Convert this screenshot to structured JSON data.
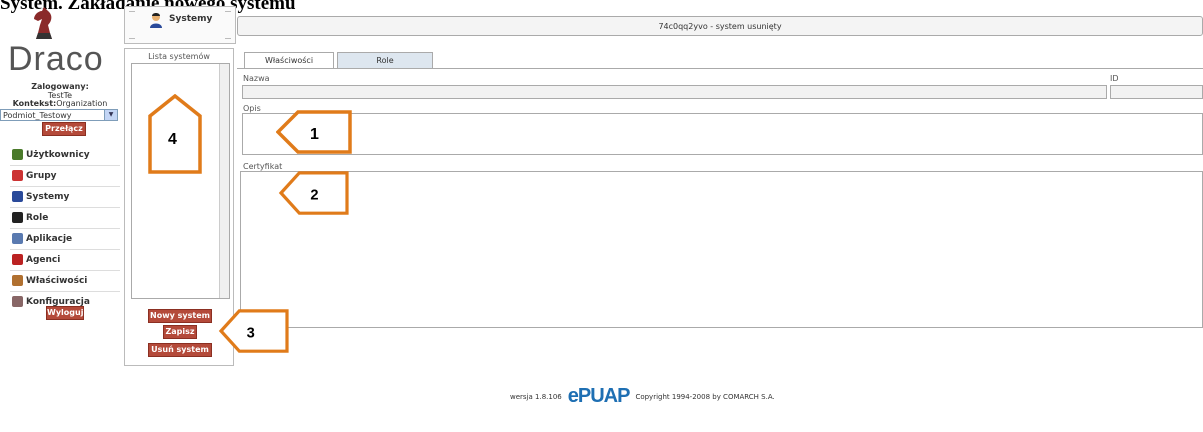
{
  "heading": "System. Zakładanie nowego systemu",
  "logo": {
    "text": "Draco"
  },
  "session": {
    "logged_label": "Zalogowany:",
    "user": "TestTe",
    "context_label": "Kontekst:",
    "context_value": "Organization",
    "subject_select": "Podmiot_Testowy",
    "switch_button": "Przełącz"
  },
  "nav": [
    {
      "label": "Użytkownicy",
      "icon": "users-icon",
      "color": "#4a7a2a"
    },
    {
      "label": "Grupy",
      "icon": "groups-icon",
      "color": "#c33"
    },
    {
      "label": "Systemy",
      "icon": "systems-icon",
      "color": "#2a4a9a"
    },
    {
      "label": "Role",
      "icon": "role-icon",
      "color": "#222"
    },
    {
      "label": "Aplikacje",
      "icon": "apps-icon",
      "color": "#5a7ab0"
    },
    {
      "label": "Agenci",
      "icon": "agents-icon",
      "color": "#b22"
    },
    {
      "label": "Właściwości",
      "icon": "properties-icon",
      "color": "#b07030"
    },
    {
      "label": "Konfiguracja",
      "icon": "config-icon",
      "color": "#866"
    }
  ],
  "logout_button": "Wyloguj",
  "module_tab": {
    "label": "Systemy",
    "icon": "systems-icon"
  },
  "window_title": "74c0qq2yvo - system usunięty",
  "list": {
    "title": "Lista systemów"
  },
  "buttons": {
    "new_system": "Nowy system",
    "save": "Zapisz",
    "delete_system": "Usuń system"
  },
  "tabs": [
    {
      "label": "Właściwości",
      "active": true
    },
    {
      "label": "Role",
      "active": false
    }
  ],
  "form": {
    "name_label": "Nazwa",
    "id_label": "ID",
    "description_label": "Opis",
    "certificate_label": "Certyfikat"
  },
  "callouts": [
    "1",
    "2",
    "3",
    "4"
  ],
  "footer": {
    "version": "wersja 1.8.106",
    "logo": "ePUAP",
    "copyright": "Copyright 1994-2008 by COMARCH S.A."
  },
  "colors": {
    "accent_red": "#b44a3a",
    "callout_orange": "#e07b1a"
  }
}
